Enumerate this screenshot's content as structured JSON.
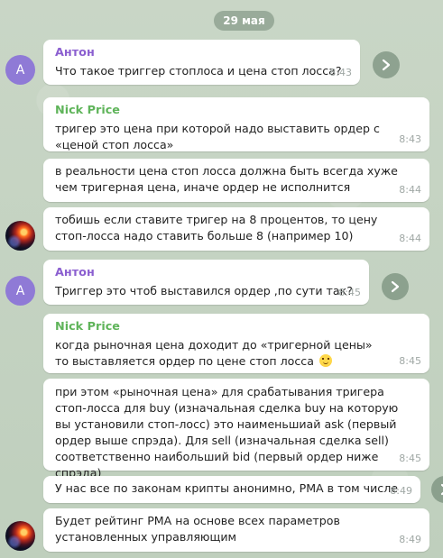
{
  "date_label": "29 мая",
  "avatar_anton_letter": "A",
  "messages": [
    {
      "sender": "Антон",
      "text": "Что такое триггер стоплоса и цена стоп лосса?",
      "time": "8:43"
    },
    {
      "sender": "Nick Price",
      "text": "тригер это цена при которой надо выставить ордер с «ценой стоп лосса»",
      "time": "8:43"
    },
    {
      "text": "в реальности цена стоп лосса должна быть всегда хуже чем тригерная цена, иначе ордер не исполнится",
      "time": "8:44"
    },
    {
      "text": "тобишь если ставите тригер на 8 процентов, то цену стоп-лосса надо ставить больше 8 (например 10)",
      "time": "8:44"
    },
    {
      "sender": "Антон",
      "text": "Триггер это чтоб выставился ордер ,по сути так?",
      "time": "8:45"
    },
    {
      "sender": "Nick Price",
      "text": "когда рыночная цена доходит до «тригерной цены» то выставляется ордер по цене стоп лосса",
      "time": "8:45",
      "emoji": "slightly-smiling-face"
    },
    {
      "text": "при этом «рыночная цена» для срабатывания тригера стоп-лосса для buy (изначальная сделка buy на которую вы установили стоп-лосс) это наименьшиай ask (первый ордер выше спрэда). Для sell (изначальная сделка sell) соответственно наибольший bid (первый ордер ниже спрэда)",
      "time": "8:45"
    },
    {
      "text": "У нас все по законам крипты анонимно, РМА в том числе",
      "time": "8:49"
    },
    {
      "text": "Будет рейтинг РМА на основе всех параметров установленных управляющим",
      "time": "8:49"
    }
  ]
}
